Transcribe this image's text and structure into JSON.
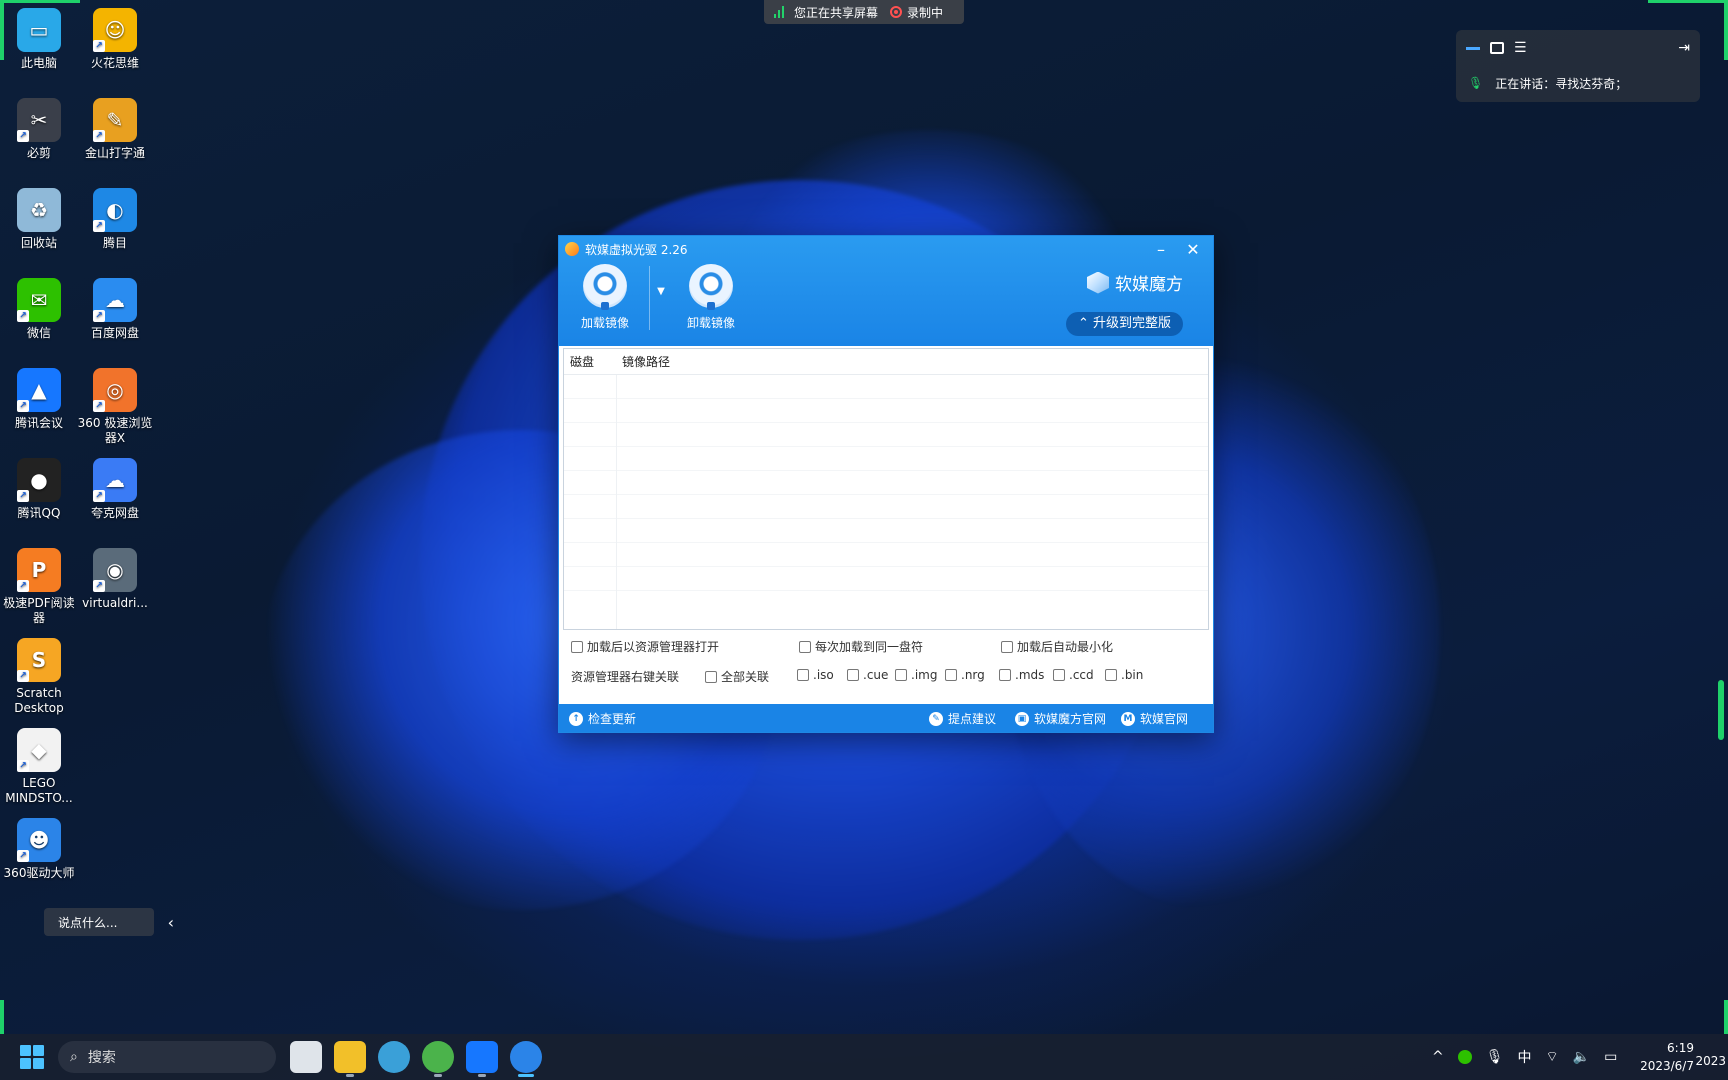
{
  "desktop": {
    "icons": [
      {
        "label": "此电脑",
        "name": "this-pc-icon",
        "color": "#29a8e8",
        "glyph": "▭"
      },
      {
        "label": "火花思维",
        "name": "huohua-icon",
        "color": "#f4b400",
        "glyph": "☺"
      },
      {
        "label": "必剪",
        "name": "bijian-icon",
        "color": "#3a3f4a",
        "glyph": "✂"
      },
      {
        "label": "金山打字通",
        "name": "jinshan-typing-icon",
        "color": "#e8a020",
        "glyph": "✎"
      },
      {
        "label": "回收站",
        "name": "recycle-bin-icon",
        "color": "#8fb9d8",
        "glyph": "♻"
      },
      {
        "label": "腾目",
        "name": "tengmu-icon",
        "color": "#1e88e5",
        "glyph": "◐"
      },
      {
        "label": "微信",
        "name": "wechat-icon",
        "color": "#2dc100",
        "glyph": "✉"
      },
      {
        "label": "百度网盘",
        "name": "baidu-netdisk-icon",
        "color": "#2a8cf0",
        "glyph": "☁"
      },
      {
        "label": "腾讯会议",
        "name": "tencent-meeting-icon",
        "color": "#1677ff",
        "glyph": "▲"
      },
      {
        "label": "360 极速浏览器X",
        "name": "360-browser-icon",
        "color": "#f1732b",
        "glyph": "◎"
      },
      {
        "label": "腾讯QQ",
        "name": "qq-icon",
        "color": "#222222",
        "glyph": "●"
      },
      {
        "label": "夸克网盘",
        "name": "quark-netdisk-icon",
        "color": "#3a7bf5",
        "glyph": "☁"
      },
      {
        "label": "极速PDF阅读器",
        "name": "pdf-reader-icon",
        "color": "#f57c22",
        "glyph": "P"
      },
      {
        "label": "virtualdri...",
        "name": "virtualdrive-icon",
        "color": "#5a6b7a",
        "glyph": "◉"
      },
      {
        "label": "Scratch Desktop",
        "name": "scratch-icon",
        "color": "#f6a623",
        "glyph": "S"
      },
      {
        "label": "LEGO MINDSTO...",
        "name": "lego-mindstorms-icon",
        "color": "#f2f2f2",
        "glyph": "◆"
      },
      {
        "label": "360驱动大师",
        "name": "360-driver-icon",
        "color": "#2b84e8",
        "glyph": "☻"
      }
    ],
    "chat_placeholder": "说点什么..."
  },
  "sharebar": {
    "sharing_text": "您正在共享屏幕",
    "recording_text": "录制中"
  },
  "meeting_widget": {
    "speaking_text": "正在讲话：寻找达芬奇；"
  },
  "app": {
    "title": "软媒虚拟光驱 2.26",
    "mount_label": "加载镜像",
    "unmount_label": "卸载镜像",
    "brand": "软媒魔方",
    "upgrade_label": "升级到完整版",
    "columns": [
      "磁盘",
      "镜像路径"
    ],
    "options": {
      "open_explorer": "加载后以资源管理器打开",
      "same_drive": "每次加载到同一盘符",
      "auto_minimize": "加载后自动最小化",
      "assoc_label": "资源管理器右键关联",
      "assoc_all": "全部关联",
      "ext_iso": ".iso",
      "ext_cue": ".cue",
      "ext_img": ".img",
      "ext_nrg": ".nrg",
      "ext_mds": ".mds",
      "ext_ccd": ".ccd",
      "ext_bin": ".bin"
    },
    "footer": {
      "check_update": "检查更新",
      "feedback": "提点建议",
      "rmmf_site": "软媒魔方官网",
      "ruanmei_site": "软媒官网"
    }
  },
  "taskbar": {
    "search_placeholder": "搜索",
    "ime": "中",
    "time": "6:19",
    "date": "2023/6/7",
    "date_cut": "2023"
  },
  "colors": {
    "accent": "#1a84e6",
    "green": "#1fd16a"
  }
}
